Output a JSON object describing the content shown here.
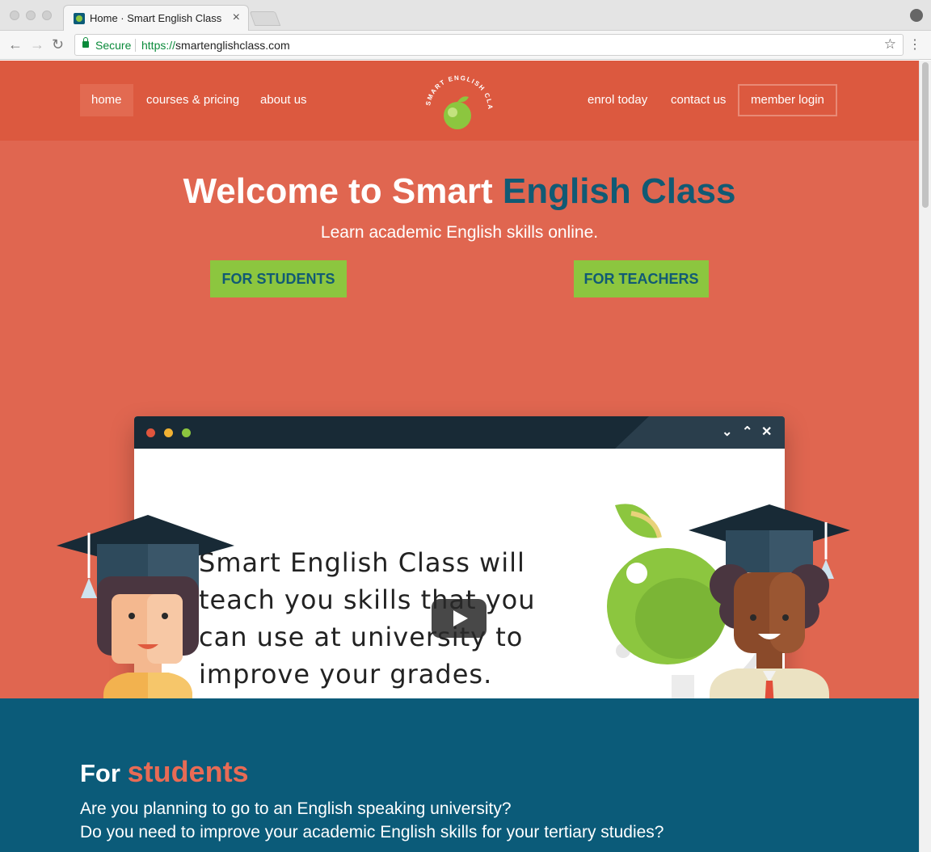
{
  "browser": {
    "tab_title": "Home · Smart English Class",
    "tab_close": "×",
    "secure_label": "Secure",
    "url_scheme": "https://",
    "url_host": "smartenglishclass.com",
    "back": "←",
    "forward": "→",
    "reload": "↻",
    "bookmark": "☆",
    "menu": "⋮"
  },
  "nav": {
    "left": [
      {
        "label": "home",
        "active": true
      },
      {
        "label": "courses & pricing"
      },
      {
        "label": "about us"
      }
    ],
    "right": [
      {
        "label": "enrol today"
      },
      {
        "label": "contact us"
      },
      {
        "label": "member login"
      }
    ],
    "logo_text": "SMART ENGLISH CLASS"
  },
  "hero": {
    "welcome": "Welcome to ",
    "smart": "Smart ",
    "english_class": "English Class",
    "subtitle": "Learn academic English skills online.",
    "btn_students": "FOR STUDENTS",
    "btn_teachers": "FOR TEACHERS"
  },
  "video": {
    "lines": [
      "Smart English Class will",
      "teach you skills that you",
      "can use at university to",
      "improve your grades."
    ],
    "controls": [
      "⌄",
      "⌃",
      "✕"
    ]
  },
  "students": {
    "for": "For ",
    "students": "students",
    "line1": "Are you planning to go to an English speaking university?",
    "line2": "Do you need to improve your academic English skills for your tertiary studies?"
  },
  "colors": {
    "header": "#dc593f",
    "hero": "#e06650",
    "navy": "#115a74",
    "green": "#8cc63f",
    "section": "#0b5b79"
  }
}
